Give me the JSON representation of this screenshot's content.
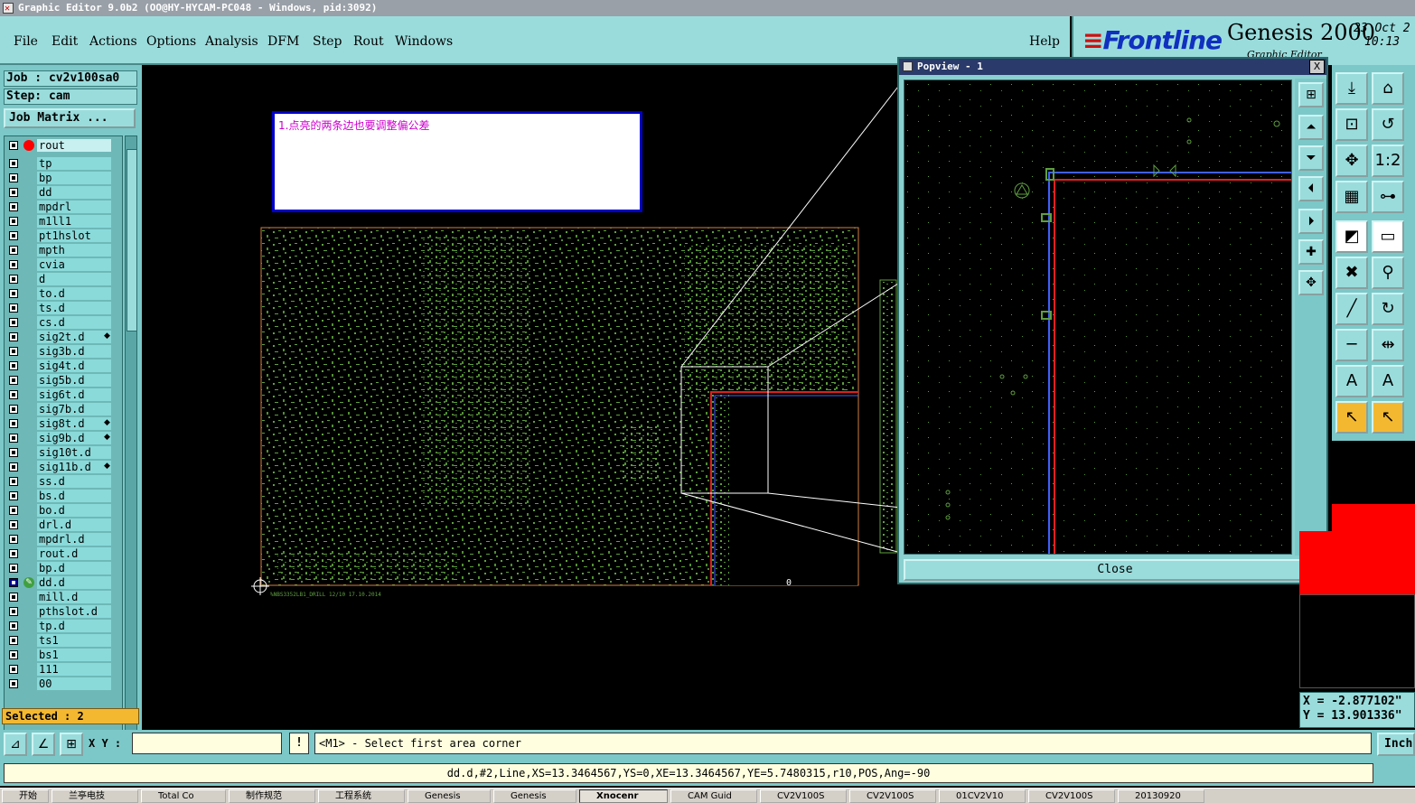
{
  "window": {
    "title": "Graphic Editor 9.0b2 (OO@HY-HYCAM-PC048 - Windows, pid:3092)"
  },
  "menu": {
    "items": [
      "File",
      "Edit",
      "Actions",
      "Options",
      "Analysis",
      "DFM",
      "Step",
      "Rout",
      "Windows"
    ],
    "help": "Help"
  },
  "brand": {
    "logo": "Frontline",
    "product": "Genesis 2000",
    "sub": "Graphic Editor",
    "date": "23 Oct 2",
    "time": "10:13"
  },
  "job": {
    "label": "Job : cv2v100sa0",
    "step": "Step: cam",
    "matrix_button": "Job Matrix ..."
  },
  "layers": [
    {
      "name": "rout",
      "active": true
    },
    {
      "name": "tp"
    },
    {
      "name": "bp"
    },
    {
      "name": "dd"
    },
    {
      "name": "mpdrl"
    },
    {
      "name": "m1ll1"
    },
    {
      "name": "pt1hslot"
    },
    {
      "name": "mpth"
    },
    {
      "name": "cvia"
    },
    {
      "name": "d"
    },
    {
      "name": "to.d"
    },
    {
      "name": "ts.d"
    },
    {
      "name": "cs.d"
    },
    {
      "name": "sig2t.d",
      "mark": true
    },
    {
      "name": "sig3b.d"
    },
    {
      "name": "sig4t.d"
    },
    {
      "name": "sig5b.d"
    },
    {
      "name": "sig6t.d"
    },
    {
      "name": "sig7b.d"
    },
    {
      "name": "sig8t.d",
      "mark": true
    },
    {
      "name": "sig9b.d",
      "mark": true
    },
    {
      "name": "sig10t.d"
    },
    {
      "name": "sig11b.d",
      "mark": true
    },
    {
      "name": "ss.d"
    },
    {
      "name": "bs.d"
    },
    {
      "name": "bo.d"
    },
    {
      "name": "drl.d"
    },
    {
      "name": "mpdrl.d"
    },
    {
      "name": "rout.d"
    },
    {
      "name": "bp.d"
    },
    {
      "name": "dd.d",
      "selected": true
    },
    {
      "name": "mill.d"
    },
    {
      "name": "pthslot.d"
    },
    {
      "name": "tp.d"
    },
    {
      "name": "ts1"
    },
    {
      "name": "bs1"
    },
    {
      "name": "111"
    },
    {
      "name": "00"
    }
  ],
  "selected_count": "Selected : 2",
  "annotation": {
    "text": "1.点亮的两条边也要调整偏公差"
  },
  "canvas": {
    "footer_text": "%NBS3352LB1_DRILL     12/10    17.10.2014",
    "origin_mark": "0"
  },
  "popview": {
    "title": "Popview - 1",
    "close_x": "X",
    "close_label": "Close"
  },
  "coords": {
    "x": "X = -2.877102\"",
    "y": "Y = 13.901336\""
  },
  "bottom": {
    "xy_label": "X Y :",
    "input_value": "",
    "warn": "!",
    "prompt": "<M1> - Select first area corner",
    "units": "Inch"
  },
  "status": {
    "text": "dd.d,#2,Line,XS=13.3464567,YS=0,XE=13.3464567,YE=5.7480315,r10,POS,Ang=-90"
  },
  "taskbar": {
    "items": [
      "开始",
      "兰亭电技",
      "Total Co",
      "制作规范",
      "工程系统",
      "Genesis",
      "Genesis",
      "Xnocenr",
      "CAM Guid",
      "CV2V100S",
      "CV2V100S",
      "01CV2V10",
      "CV2V100S",
      "20130920"
    ],
    "active_index": 7
  },
  "colors": {
    "teal": "#9adcdc",
    "panel": "#7cc8c8",
    "pcb_green": "#5fa040",
    "rout_red": "#e02020",
    "rout_blue": "#4060ff",
    "selected_yellow": "#f4b830"
  }
}
